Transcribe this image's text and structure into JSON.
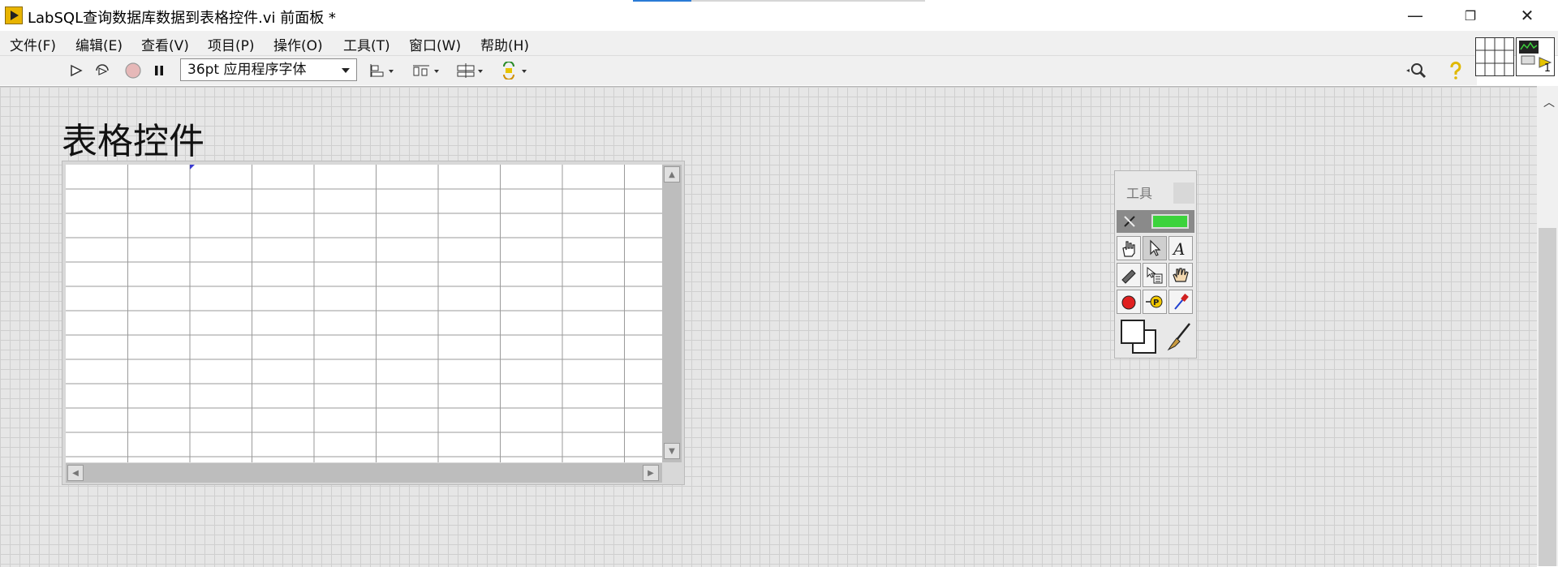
{
  "window": {
    "title": "LabSQL查询数据库数据到表格控件.vi 前面板 *",
    "minimize_label": "—",
    "restore_label": "❐",
    "close_label": "✕"
  },
  "menu": [
    {
      "label": "文件(F)"
    },
    {
      "label": "编辑(E)"
    },
    {
      "label": "查看(V)"
    },
    {
      "label": "项目(P)"
    },
    {
      "label": "操作(O)"
    },
    {
      "label": "工具(T)"
    },
    {
      "label": "窗口(W)"
    },
    {
      "label": "帮助(H)"
    }
  ],
  "toolbar": {
    "run_icon": "run-arrow-icon",
    "run_continuous_icon": "run-continuous-icon",
    "abort_icon": "abort-icon",
    "pause_icon": "pause-icon",
    "font_value": "36pt 应用程序字体",
    "align_icon": "align-objects-icon",
    "distribute_icon": "distribute-objects-icon",
    "resize_icon": "resize-objects-icon",
    "reorder_icon": "reorder-icon",
    "search_icon": "search-icon",
    "help_icon": "context-help-icon",
    "vi_icon_number": "1"
  },
  "front_panel": {
    "table_label": "表格控件",
    "table_rows": 12,
    "table_cols": 10
  },
  "tools_palette": {
    "title": "工具",
    "tools": [
      "operate-value-icon",
      "position-select-icon",
      "edit-text-icon",
      "connect-wire-icon",
      "object-shortcut-menu-icon",
      "scroll-window-icon",
      "set-clear-breakpoint-icon",
      "probe-data-icon",
      "get-color-icon"
    ],
    "color_swatch_icon": "set-color-icon",
    "brush_icon": "paintbrush-icon"
  },
  "colors": {
    "canvas": "#e6e6e6",
    "grid_line": "#cfcfcf",
    "auto_tool_led": "#3cd33c"
  }
}
